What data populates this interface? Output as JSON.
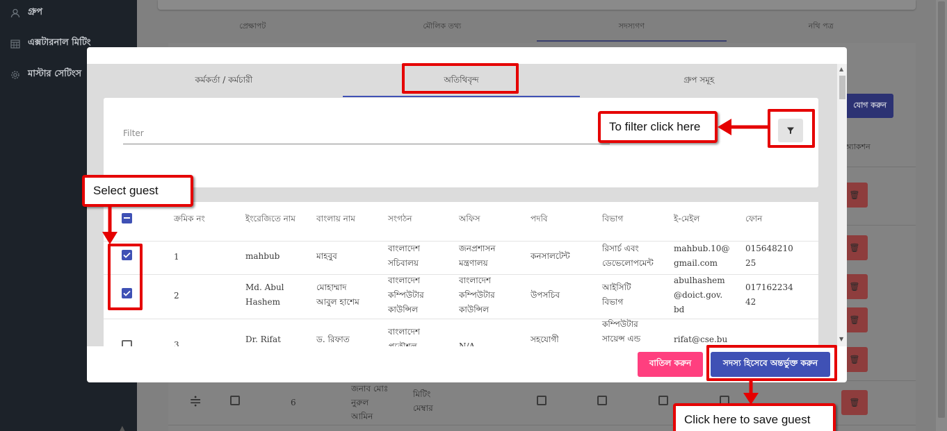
{
  "sidebar": {
    "items": [
      {
        "label": "গ্রুপ",
        "icon": "users-icon"
      },
      {
        "label": "এক্সটারনাল মিটিং",
        "icon": "calendar-icon"
      },
      {
        "label": "মাস্টার সেটিংস",
        "icon": "gear-icon"
      }
    ]
  },
  "background": {
    "tabs": [
      "প্রেক্ষাপট",
      "মৌলিক তথ্য",
      "সদস্যগণ",
      "নথি পত্র"
    ],
    "add_button": "যোগ করুন",
    "action_header": "অ্যাকশন",
    "row6": {
      "serial": "6",
      "name": "জনাব মোঃ নুরুল আমিন",
      "role": "মিটিং মেম্বার"
    }
  },
  "modal": {
    "tabs": [
      "কর্মকর্তা / কর্মচারী",
      "অতিথিবৃন্দ",
      "গ্রুপ সমূহ"
    ],
    "filter_placeholder": "Filter",
    "headers": [
      "ক্রমিক নং",
      "ইংরেজিতে নাম",
      "বাংলায় নাম",
      "সংগঠন",
      "অফিস",
      "পদবি",
      "বিভাগ",
      "ই-মেইল",
      "ফোন"
    ],
    "rows": [
      {
        "checked": true,
        "serial": "1",
        "name_en": "mahbub",
        "name_bn": "মাহবুব",
        "org": "বাংলাদেশ সচিবালয়",
        "office": "জনপ্রশাসন মন্ত্রণালয়",
        "designation": "কনসালটেন্ট",
        "department": "রিসার্চ এবং ডেভেলোপমেন্ট",
        "email": "mahbub.10@gmail.com",
        "phone": "01564821025"
      },
      {
        "checked": true,
        "serial": "2",
        "name_en": "Md. Abul Hashem",
        "name_bn": "মোহাম্মাদ আবুল হাশেম",
        "org": "বাংলাদেশ কম্পিউটার কাউন্সিল",
        "office": "বাংলাদেশ কম্পিউটার কাউন্সিল",
        "designation": "উপসচিব",
        "department": "আইসিটি বিভাগ",
        "email": "abulhashem@doict.gov.bd",
        "phone": "01716223442"
      },
      {
        "checked": false,
        "serial": "3",
        "name_en": "Dr. Rifat",
        "name_bn": "ড. রিফাত",
        "org": "বাংলাদেশ প্রকৌশল",
        "office": "N/A",
        "designation": "সহযোগী",
        "department": "কম্পিউটার সায়েন্স এন্ড",
        "email": "rifat@cse.bu",
        "phone": ""
      }
    ],
    "cancel_label": "বাতিল করুন",
    "save_label": "সদস্য হিসেবে অন্তর্ভুক্ত করুন"
  },
  "annotations": {
    "filter_note": "To filter click here",
    "select_note": "Select guest",
    "save_note": "Click here to save guest"
  },
  "colors": {
    "primary": "#3f51b5",
    "cancel": "#ff3f7f",
    "annotation_red": "#e50000"
  }
}
